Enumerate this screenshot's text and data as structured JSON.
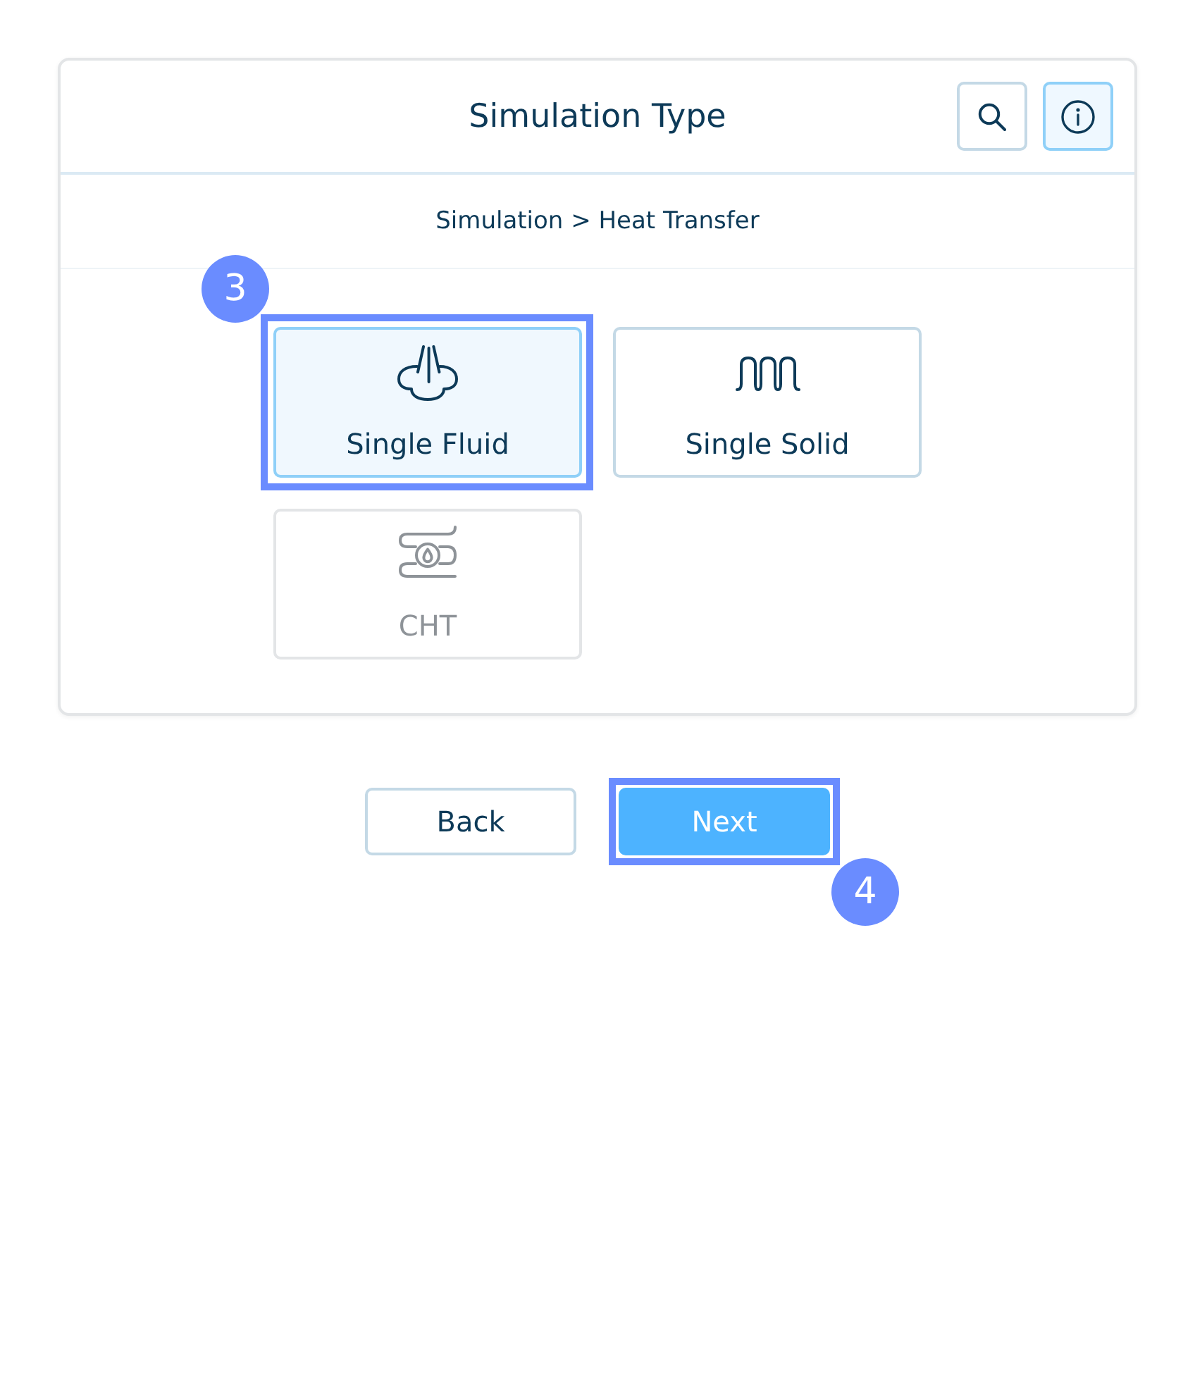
{
  "dialog": {
    "title": "Simulation Type",
    "actions": [
      {
        "kind": "search",
        "selected": false
      },
      {
        "kind": "info",
        "selected": true
      }
    ]
  },
  "breadcrumb": "Simulation > Heat Transfer",
  "options": [
    {
      "label": "Single Fluid",
      "kind": "fluid",
      "selected": true,
      "disabled": false,
      "tour_step": "3"
    },
    {
      "label": "Single Solid",
      "kind": "solid",
      "selected": false,
      "disabled": false
    },
    {
      "label": "CHT",
      "kind": "cht",
      "selected": false,
      "disabled": true
    }
  ],
  "buttons": [
    {
      "label": "Back",
      "kind": "secondary"
    },
    {
      "label": "Next",
      "kind": "primary",
      "tour_step": "4"
    }
  ]
}
